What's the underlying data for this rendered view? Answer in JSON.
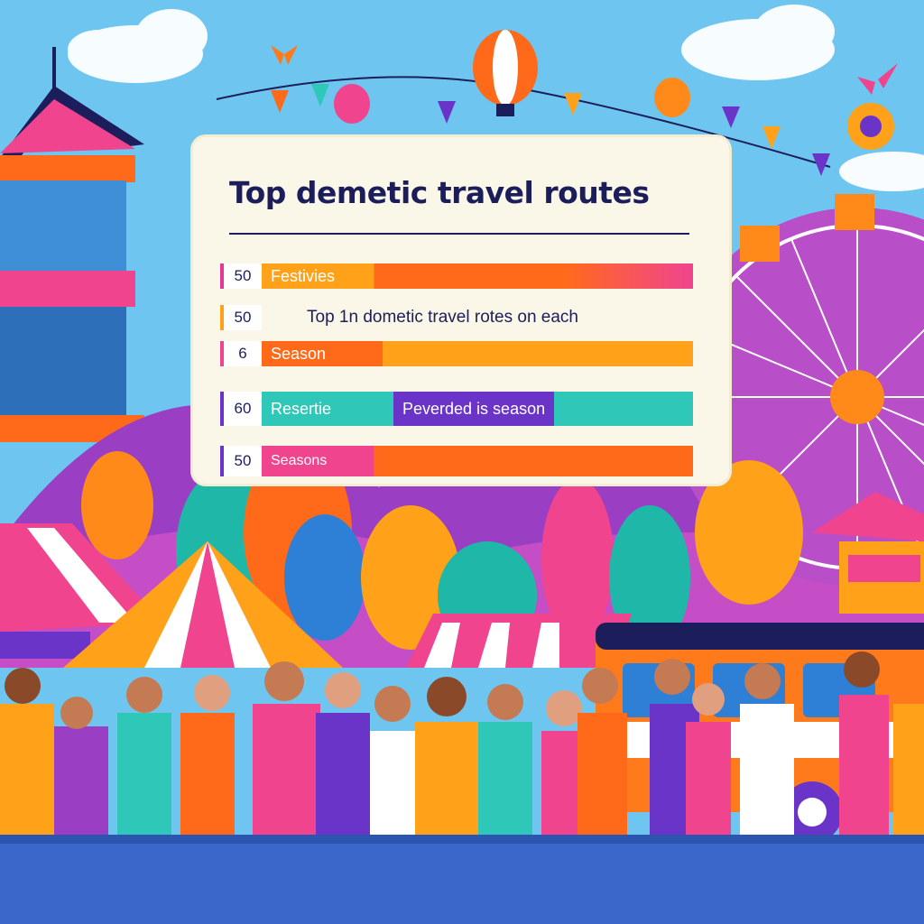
{
  "chart_data": {
    "type": "bar",
    "title": "Top demetic travel routes",
    "rows": [
      {
        "value_label": "50",
        "label": "Festivies",
        "value": 50
      },
      {
        "value_label": "50",
        "label": "Top 1n dometic travel rotes on each",
        "value": null
      },
      {
        "value_label": "6",
        "label": "Season",
        "value": 6
      },
      {
        "value_label": "60",
        "label": "Resertie",
        "chip": "Peverded is season",
        "value": 60
      },
      {
        "value_label": "50",
        "label": "Seasons",
        "value": 50
      }
    ]
  },
  "colors": {
    "sky": "#6ec6f0",
    "pink": "#f0448f",
    "orange": "#ff6a1a",
    "amber": "#ffa21a",
    "teal": "#2ec7b8",
    "purple": "#6a34c8",
    "navy": "#1b1e5a",
    "ground": "#3a67c9"
  },
  "icons": [
    "butterfly-icon",
    "hot-air-balloon-icon",
    "ferris-wheel-icon",
    "pagoda-icon",
    "tent-icon",
    "bus-icon"
  ]
}
